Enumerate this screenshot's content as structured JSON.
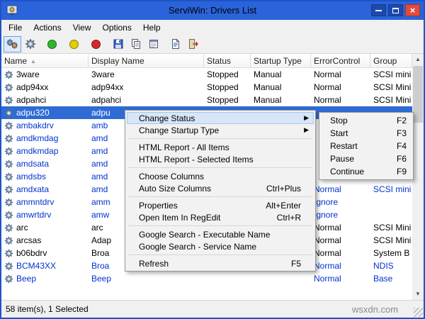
{
  "window": {
    "title": "ServiWin: Drivers List"
  },
  "menubar": [
    "File",
    "Actions",
    "View",
    "Options",
    "Help"
  ],
  "toolbar": {
    "buttons": [
      "drivers-view",
      "services-view",
      "start-driver",
      "pause-driver",
      "stop-driver",
      "save-selected",
      "copy-selected",
      "properties",
      "html-report",
      "exit"
    ]
  },
  "colors": {
    "titlebar": "#2a63da",
    "selection": "#2e6bd5",
    "running_text": "#0033cc",
    "start_button": "#2eb52e",
    "pause_button": "#e0cf00",
    "stop_button": "#d42a2a"
  },
  "columns": [
    "Name",
    "Display Name",
    "Status",
    "Startup Type",
    "ErrorControl",
    "Group"
  ],
  "rows": [
    {
      "name": "3ware",
      "display": "3ware",
      "status": "Stopped",
      "startup": "Manual",
      "error": "Normal",
      "group": "SCSI mini",
      "state": "stopped"
    },
    {
      "name": "adp94xx",
      "display": "adp94xx",
      "status": "Stopped",
      "startup": "Manual",
      "error": "Normal",
      "group": "SCSI Mini",
      "state": "stopped"
    },
    {
      "name": "adpahci",
      "display": "adpahci",
      "status": "Stopped",
      "startup": "Manual",
      "error": "Normal",
      "group": "SCSI Mini",
      "state": "stopped"
    },
    {
      "name": "adpu320",
      "display": "adpu",
      "status": "",
      "startup": "",
      "error": "",
      "group": "",
      "state": "selected"
    },
    {
      "name": "ambakdrv",
      "display": "amb",
      "status": "",
      "startup": "",
      "error": "",
      "group": "",
      "state": "running"
    },
    {
      "name": "amdkmdag",
      "display": "amd",
      "status": "",
      "startup": "",
      "error": "",
      "group": "",
      "state": "running"
    },
    {
      "name": "amdkmdap",
      "display": "amd",
      "status": "",
      "startup": "",
      "error": "",
      "group": "",
      "state": "running"
    },
    {
      "name": "amdsata",
      "display": "amd",
      "status": "",
      "startup": "",
      "error": "",
      "group": "",
      "state": "running"
    },
    {
      "name": "amdsbs",
      "display": "amd",
      "status": "",
      "startup": "",
      "error": "",
      "group": "",
      "state": "running"
    },
    {
      "name": "amdxata",
      "display": "amd",
      "status": "",
      "startup": "",
      "error": "Normal",
      "group": "SCSI mini",
      "state": "running"
    },
    {
      "name": "ammntdrv",
      "display": "amm",
      "status": "",
      "startup": "",
      "error": "Ignore",
      "group": "",
      "state": "running"
    },
    {
      "name": "amwrtdrv",
      "display": "amw",
      "status": "",
      "startup": "",
      "error": "Ignore",
      "group": "",
      "state": "running"
    },
    {
      "name": "arc",
      "display": "arc",
      "status": "",
      "startup": "",
      "error": "Normal",
      "group": "SCSI Mini",
      "state": "stopped"
    },
    {
      "name": "arcsas",
      "display": "Adap",
      "status": "",
      "startup": "",
      "error": "Normal",
      "group": "SCSI Mini",
      "state": "stopped"
    },
    {
      "name": "b06bdrv",
      "display": "Broa",
      "status": "",
      "startup": "",
      "error": "Normal",
      "group": "System B",
      "state": "stopped"
    },
    {
      "name": "BCM43XX",
      "display": "Broa",
      "status": "",
      "startup": "",
      "error": "Normal",
      "group": "NDIS",
      "state": "running"
    },
    {
      "name": "Beep",
      "display": "Beep",
      "status": "",
      "startup": "",
      "error": "Normal",
      "group": "Base",
      "state": "running"
    }
  ],
  "context_menu": {
    "items": [
      {
        "label": "Change Status",
        "arrow": "▶",
        "state": "highlight"
      },
      {
        "label": "Change Startup Type",
        "arrow": "▶"
      },
      {
        "separator": true
      },
      {
        "label": "HTML Report - All Items"
      },
      {
        "label": "HTML Report - Selected Items"
      },
      {
        "separator": true
      },
      {
        "label": "Choose Columns"
      },
      {
        "label": "Auto Size Columns",
        "shortcut": "Ctrl+Plus"
      },
      {
        "separator": true
      },
      {
        "label": "Properties",
        "shortcut": "Alt+Enter"
      },
      {
        "label": "Open Item In RegEdit",
        "shortcut": "Ctrl+R"
      },
      {
        "separator": true
      },
      {
        "label": "Google Search - Executable Name"
      },
      {
        "label": "Google Search - Service Name"
      },
      {
        "separator": true
      },
      {
        "label": "Refresh",
        "shortcut": "F5"
      }
    ]
  },
  "submenu": {
    "items": [
      {
        "label": "Stop",
        "shortcut": "F2"
      },
      {
        "label": "Start",
        "shortcut": "F3"
      },
      {
        "label": "Restart",
        "shortcut": "F4"
      },
      {
        "label": "Pause",
        "shortcut": "F6"
      },
      {
        "label": "Continue",
        "shortcut": "F9"
      }
    ]
  },
  "statusbar": {
    "text": "58 item(s), 1 Selected",
    "watermark": "wsxdn.com"
  },
  "icons": {
    "sort": "▲",
    "scroll_up": "▲",
    "scroll_down": "▼",
    "close": "×"
  }
}
